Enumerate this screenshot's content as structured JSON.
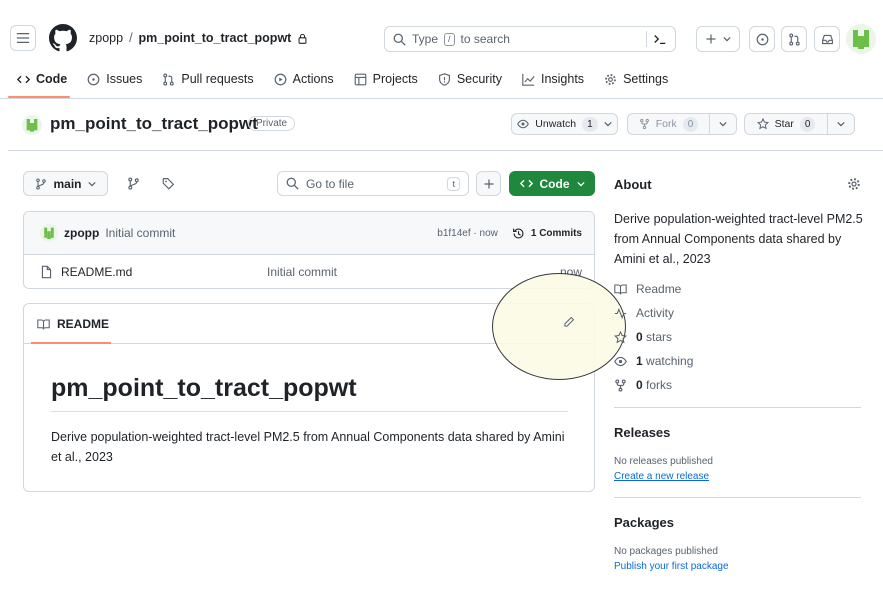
{
  "header": {
    "owner": "zpopp",
    "separator": "/",
    "repo": "pm_point_to_tract_popwt",
    "search_placeholder_prefix": "Type",
    "search_key": "/",
    "search_placeholder_suffix": "to search"
  },
  "tabs": [
    "Code",
    "Issues",
    "Pull requests",
    "Actions",
    "Projects",
    "Security",
    "Insights",
    "Settings"
  ],
  "repo_header": {
    "name": "pm_point_to_tract_popwt",
    "visibility": "Private",
    "unwatch_label": "Unwatch",
    "watch_count": "1",
    "fork_label": "Fork",
    "fork_count": "0",
    "star_label": "Star",
    "star_count": "0"
  },
  "toolbar": {
    "branch": "main",
    "goto_placeholder": "Go to file",
    "goto_key": "t",
    "code_label": "Code"
  },
  "commit": {
    "author": "zpopp",
    "message": "Initial commit",
    "hash": "b1f14ef · now",
    "commits_label": "1 Commits"
  },
  "files": [
    {
      "name": "README.md",
      "message": "Initial commit",
      "time": "now"
    }
  ],
  "readme": {
    "tab_label": "README",
    "title": "pm_point_to_tract_popwt",
    "body": "Derive population-weighted tract-level PM2.5 from Annual Components data shared by Amini et al., 2023"
  },
  "about": {
    "heading": "About",
    "description": "Derive population-weighted tract-level PM2.5 from Annual Components data shared by Amini et al., 2023",
    "readme_label": "Readme",
    "activity_label": "Activity",
    "stars_count": "0",
    "stars_label": "stars",
    "watching_count": "1",
    "watching_label": "watching",
    "forks_count": "0",
    "forks_label": "forks"
  },
  "releases": {
    "heading": "Releases",
    "empty": "No releases published",
    "link": "Create a new release"
  },
  "packages": {
    "heading": "Packages",
    "empty": "No packages published",
    "link": "Publish your first package"
  },
  "colors": {
    "accent_green": "#1f883d",
    "link_blue": "#0969da",
    "tab_underline": "#fd8c73",
    "highlight_fill": "#fbfbe6"
  }
}
